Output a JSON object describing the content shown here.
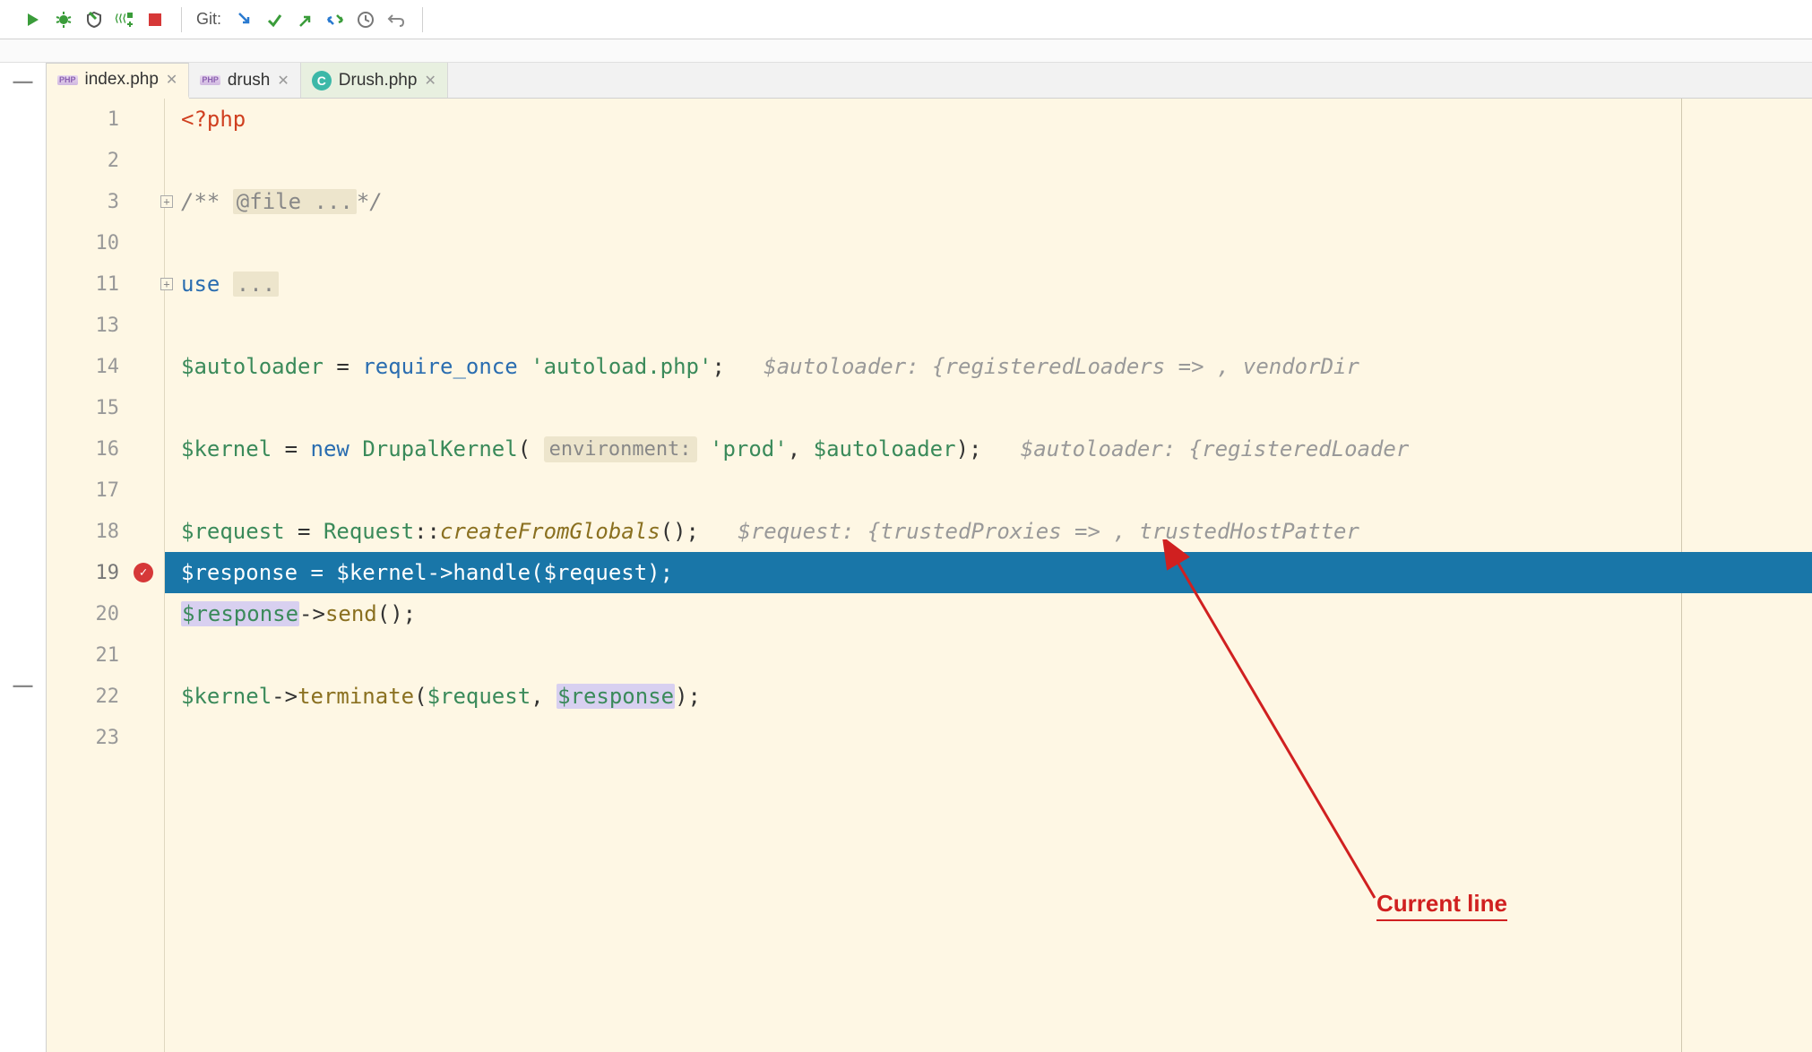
{
  "toolbar": {
    "git_label": "Git:"
  },
  "tabs": [
    {
      "label": "index.php",
      "icon": "php"
    },
    {
      "label": "drush",
      "icon": "php"
    },
    {
      "label": "Drush.php",
      "icon": "c"
    }
  ],
  "gutter_lines": [
    "1",
    "2",
    "3",
    "10",
    "11",
    "13",
    "14",
    "15",
    "16",
    "17",
    "18",
    "19",
    "20",
    "21",
    "22",
    "23"
  ],
  "breakpoint_line_index": 11,
  "code": {
    "l1_tag": "<?php",
    "l3_comment_open": "/** ",
    "l3_comment_tag": "@file ...",
    "l3_comment_close": "*/",
    "l11_use": "use ",
    "l11_folded": "...",
    "l14_var": "$autoloader",
    "l14_eq": " = ",
    "l14_kw": "require_once ",
    "l14_str": "'autoload.php'",
    "l14_semi": ";",
    "l14_inline": "   $autoloader: {registeredLoaders => , vendorDir",
    "l16_var": "$kernel",
    "l16_eq": " = ",
    "l16_new": "new ",
    "l16_class": "DrupalKernel",
    "l16_paren": "( ",
    "l16_hint": "environment:",
    "l16_str": " 'prod'",
    "l16_comma": ", ",
    "l16_var2": "$autoloader",
    "l16_close": ");",
    "l16_inline": "   $autoloader: {registeredLoader",
    "l18_var": "$request",
    "l18_eq": " = ",
    "l18_class": "Request",
    "l18_sep": "::",
    "l18_method": "createFromGlobals",
    "l18_call": "();",
    "l18_inline": "   $request: {trustedProxies => , trustedHostPatter",
    "l19_code": "$response = $kernel->handle($request);",
    "l20_var": "$response",
    "l20_arrow": "->",
    "l20_method": "send",
    "l20_call": "();",
    "l22_var": "$kernel",
    "l22_arrow": "->",
    "l22_method": "terminate",
    "l22_open": "(",
    "l22_var2": "$request",
    "l22_comma": ", ",
    "l22_var3": "$response",
    "l22_close": ");"
  },
  "annotation": {
    "label": "Current line"
  }
}
